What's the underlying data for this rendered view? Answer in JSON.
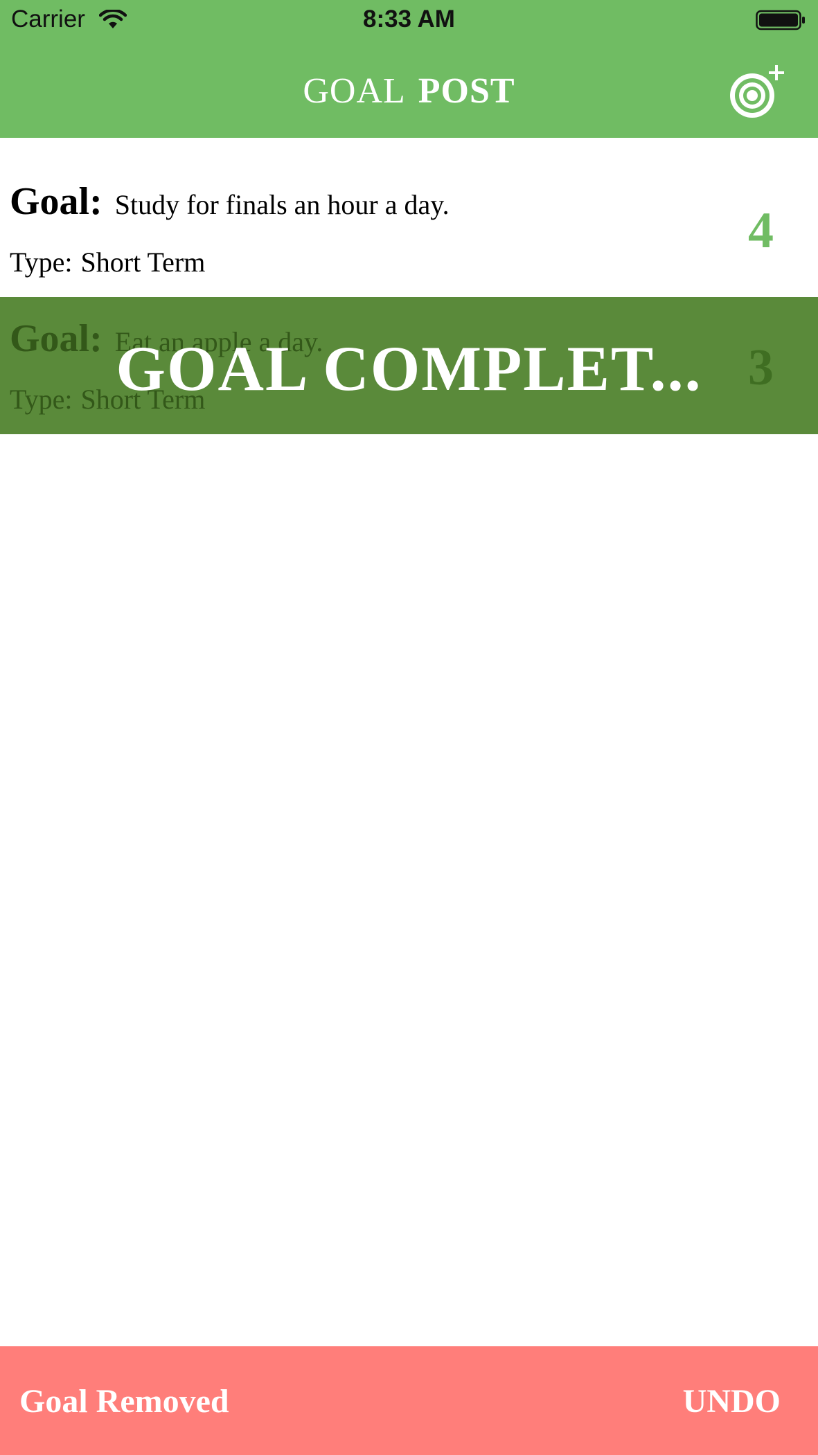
{
  "status_bar": {
    "carrier": "Carrier",
    "time": "8:33 AM",
    "wifi_icon": "wifi-icon",
    "battery_icon": "battery-icon"
  },
  "header": {
    "title_light": "GOAL",
    "title_bold": "POST",
    "add_button_icon": "target-plus-icon",
    "background_color": "#70bc63"
  },
  "goals": [
    {
      "goal_label": "Goal:",
      "goal_text": "Study for finals an hour a day.",
      "type_label": "Type:",
      "type_value": "Short Term",
      "count": "4"
    },
    {
      "goal_label": "Goal:",
      "goal_text": "Eat an apple a day.",
      "type_label": "Type:",
      "type_value": "Short Term",
      "count": "3",
      "overlay_text": "GOAL COMPLET..."
    }
  ],
  "snackbar": {
    "message": "Goal Removed",
    "action": "UNDO",
    "background_color": "#ff7e7a"
  }
}
